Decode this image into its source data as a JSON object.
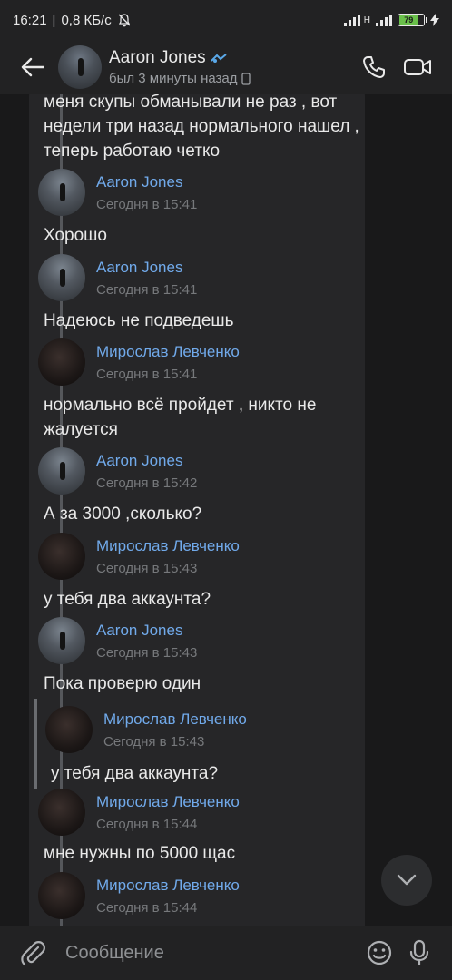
{
  "status_bar": {
    "time": "16:21",
    "speed": "0,8 КБ/с",
    "battery": "79",
    "network": "H"
  },
  "header": {
    "name": "Aaron Jones",
    "status": "был 3 минуты назад"
  },
  "feed": {
    "top_text": "меня скупы обманывали не раз , вот недели три назад нормального нашел , теперь работаю четко",
    "messages": [
      {
        "name": "Aaron Jones",
        "time": "Сегодня в 15:41",
        "text": "Хорошо"
      },
      {
        "name": "Aaron Jones",
        "time": "Сегодня в 15:41",
        "text": "Надеюсь не подведешь"
      },
      {
        "name": "Мирослав Левченко",
        "time": "Сегодня в 15:41",
        "text": "нормально всё пройдет , никто не жалуется"
      },
      {
        "name": "Aaron Jones",
        "time": "Сегодня в 15:42",
        "text": "А за 3000 ,сколько?"
      },
      {
        "name": "Мирослав Левченко",
        "time": "Сегодня в 15:43",
        "text": "у тебя два аккаунта?"
      },
      {
        "name": "Aaron Jones",
        "time": "Сегодня в 15:43",
        "text": "Пока проверю один"
      },
      {
        "name": "Мирослав Левченко",
        "time": "Сегодня в 15:43",
        "text": "у тебя два аккаунта?"
      },
      {
        "name": "Мирослав Левченко",
        "time": "Сегодня в 15:44",
        "text": "мне нужны по 5000 щас"
      },
      {
        "name": "Мирослав Левченко",
        "time": "Сегодня в 15:44",
        "text": ""
      }
    ]
  },
  "input": {
    "placeholder": "Сообщение"
  },
  "colors": {
    "accent_name": "#71aaeb",
    "background": "#19191a",
    "battery_fill": "#6ac04a"
  }
}
